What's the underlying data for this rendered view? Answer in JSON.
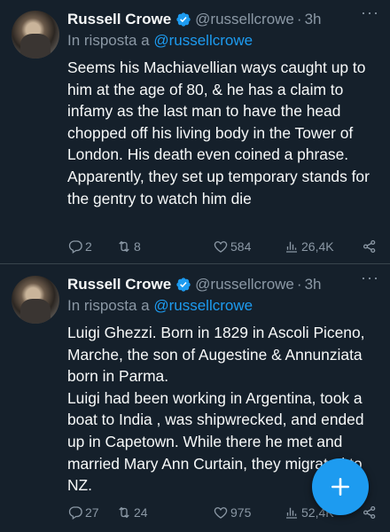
{
  "tweets": [
    {
      "author_name": "Russell Crowe",
      "handle": "@russellcrowe",
      "dot": "·",
      "time": "3h",
      "reply_prefix": "In risposta a",
      "reply_to": "@russellcrowe",
      "paragraphs": [
        "Seems his Machiavellian ways caught up to him at the age of 80, & he has a claim to infamy as the last man to have the head chopped off his living body in the Tower of London. His death even coined a phrase.",
        "Apparently, they set up temporary stands for the gentry to watch him die"
      ],
      "replies": "2",
      "retweets": "8",
      "likes": "584",
      "views": "26,4K"
    },
    {
      "author_name": "Russell Crowe",
      "handle": "@russellcrowe",
      "dot": "·",
      "time": "3h",
      "reply_prefix": "In risposta a",
      "reply_to": "@russellcrowe",
      "paragraphs": [
        "Luigi Ghezzi. Born in 1829 in Ascoli Piceno, Marche, the son of Augestine & Annunziata born in Parma.",
        "Luigi had been working in Argentina, took a boat to India , was shipwrecked, and ended up in Capetown. While there he met and married Mary Ann Curtain, they migrated to NZ."
      ],
      "replies": "27",
      "retweets": "24",
      "likes": "975",
      "views": "52,4K"
    }
  ],
  "more_menu": "···",
  "colors": {
    "background": "#15202b",
    "accent": "#1d9bf0",
    "muted": "#8b98a5",
    "divider": "#38444d"
  },
  "icons": [
    "verified-badge-icon",
    "more-icon",
    "reply-icon",
    "retweet-icon",
    "like-icon",
    "views-icon",
    "share-icon",
    "compose-plus-icon"
  ]
}
